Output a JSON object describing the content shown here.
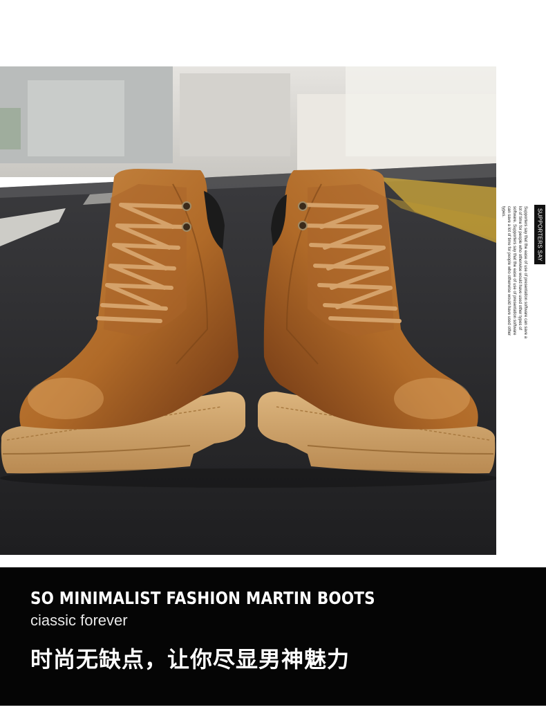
{
  "side_label": "SUPPORTERS SAY",
  "side_text": "Supporters say that the ease of use of presentation software can save a lot of time for people who otherwise would have used other types of software. Supporters say that the ease of use of presentation software can save a lot of time for people who otherwise would have used other types.",
  "banner": {
    "title": "SO MINIMALIST FASHION MARTIN BOOTS",
    "subtitle": "ciassic forever",
    "chinese_tagline": "时尚无缺点，让你尽显男神魅力"
  },
  "colors": {
    "leather": "#b8742f",
    "sole": "#cfa56c",
    "asphalt": "#2c2c2e",
    "banner_bg": "#050505"
  }
}
